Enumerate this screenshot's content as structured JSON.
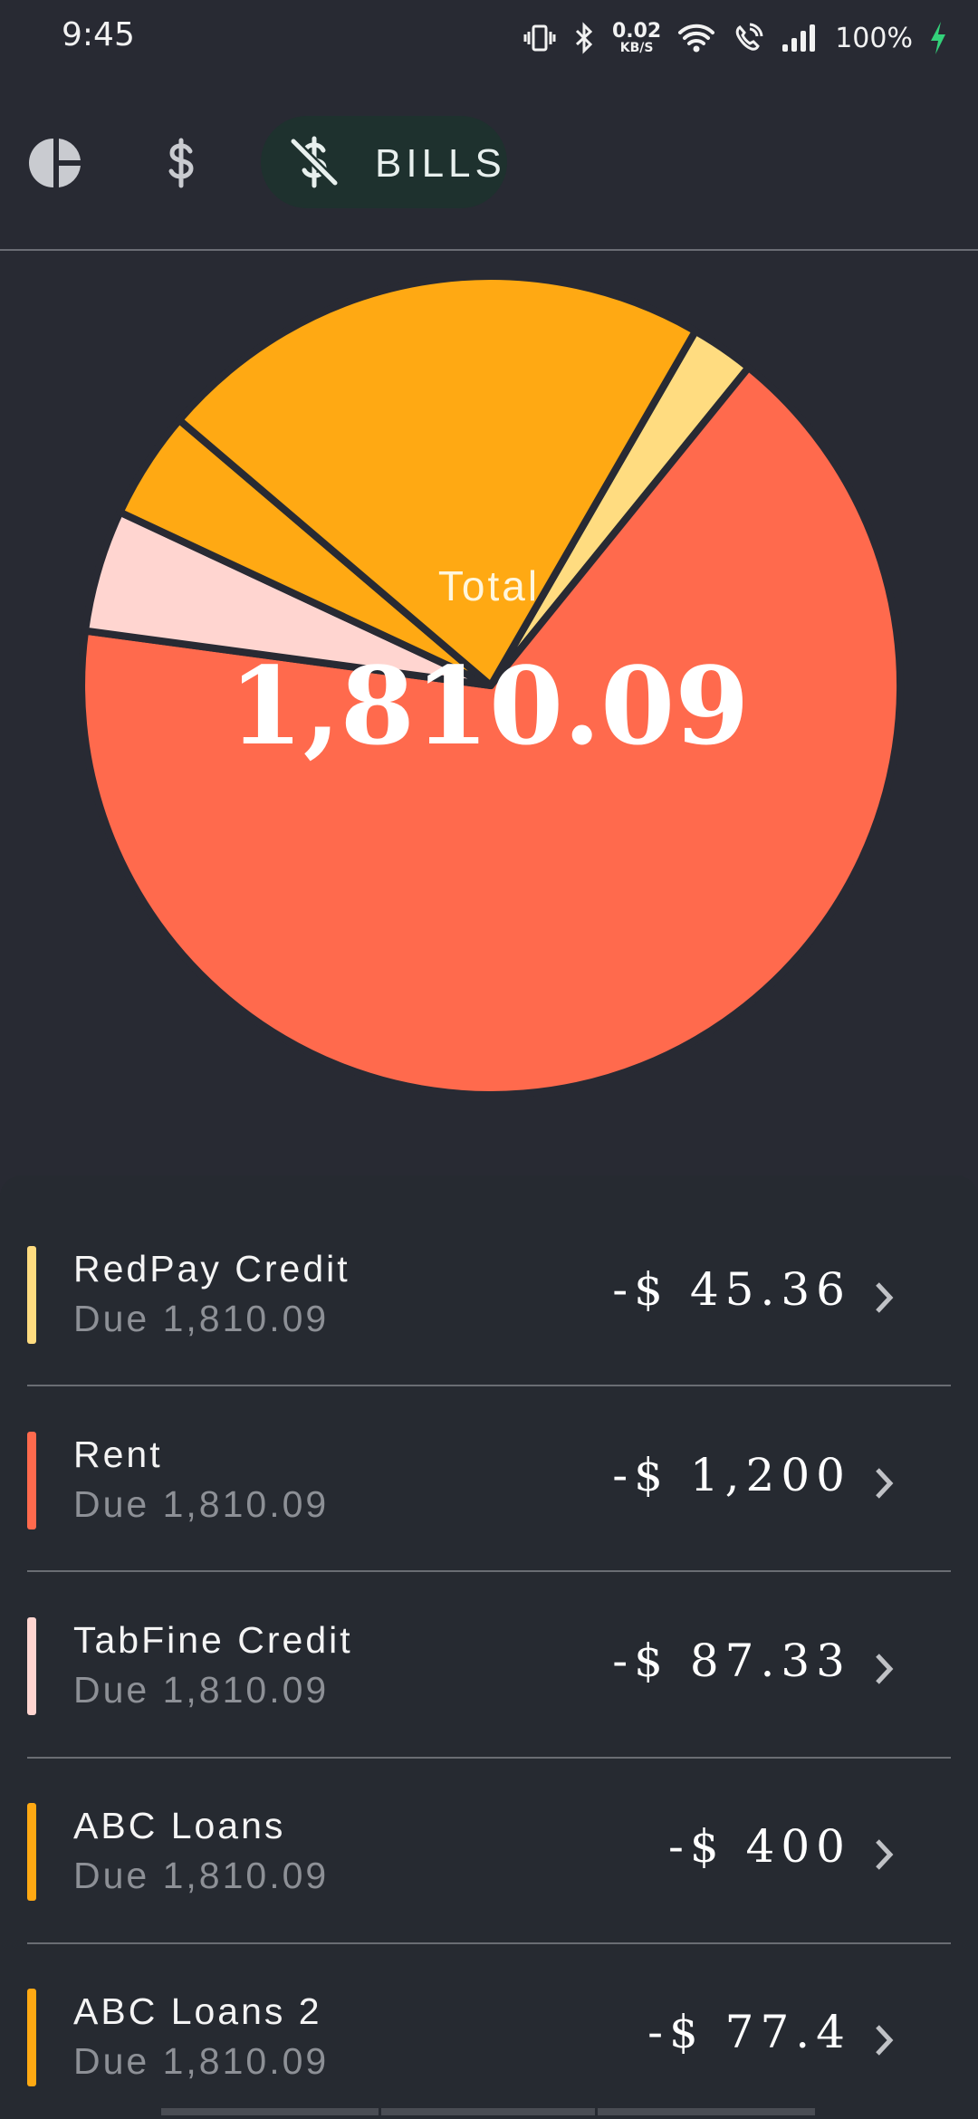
{
  "status_bar": {
    "time": "9:45",
    "net_speed_value": "0.02",
    "net_speed_unit": "KB/S",
    "battery": "100%"
  },
  "tabs": {
    "bills_label": "BILLS",
    "icons": [
      "pie-chart-icon",
      "dollar-icon",
      "no-dollar-icon"
    ]
  },
  "chart": {
    "total_label": "Total",
    "total_value": "1,810.09"
  },
  "chart_data": {
    "type": "pie",
    "slices": [
      {
        "label": "RedPay Credit",
        "value": 45.36,
        "color": "#ffdc80"
      },
      {
        "label": "Rent",
        "value": 1200,
        "color": "#ff6a4d"
      },
      {
        "label": "TabFine Credit",
        "value": 87.33,
        "color": "#ffd5d0"
      },
      {
        "label": "ABC Loans",
        "value": 400,
        "color": "#ffa913"
      },
      {
        "label": "ABC Loans 2",
        "value": 77.4,
        "color": "#ffa913"
      }
    ]
  },
  "bills": [
    {
      "name": "RedPay Credit",
      "due": "Due 1,810.09",
      "amount": "-$ 45.36",
      "color": "#ffdc80"
    },
    {
      "name": "Rent",
      "due": "Due 1,810.09",
      "amount": "-$ 1,200",
      "color": "#ff6a4d"
    },
    {
      "name": "TabFine Credit",
      "due": "Due 1,810.09",
      "amount": "-$ 87.33",
      "color": "#ffd5d0"
    },
    {
      "name": "ABC Loans",
      "due": "Due 1,810.09",
      "amount": "-$ 400",
      "color": "#ffa913"
    },
    {
      "name": "ABC Loans 2",
      "due": "Due 1,810.09",
      "amount": "-$ 77.4",
      "color": "#ffa913"
    }
  ]
}
